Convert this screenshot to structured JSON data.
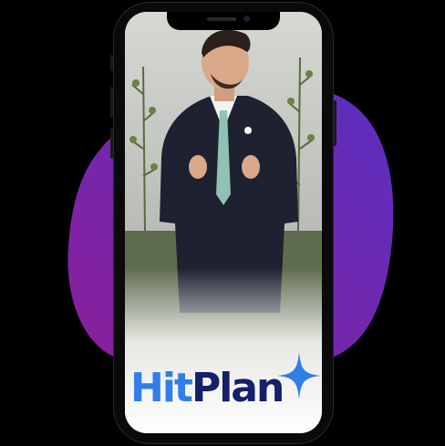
{
  "brand": {
    "hit": "Hit",
    "plan": "Plan",
    "hit_color": "#2f7fe6",
    "plan_color": "#14206a",
    "sparkle_color": "#2f7fe6",
    "icon": "sparkle-icon"
  },
  "background": {
    "blob_colors": [
      "#8a1f9a",
      "#5a2fc0"
    ]
  },
  "device": {
    "type": "smartphone"
  }
}
